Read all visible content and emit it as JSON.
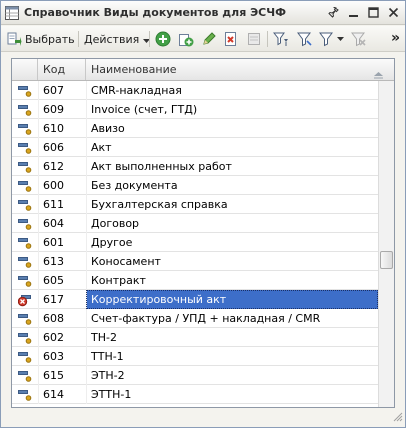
{
  "window": {
    "title": "Справочник Виды документов для ЭСЧФ"
  },
  "toolbar": {
    "select_label": "Выбрать",
    "actions_label": "Действия",
    "more_glyph": "»"
  },
  "grid": {
    "columns": {
      "code": "Код",
      "name": "Наименование"
    },
    "rows": [
      {
        "code": "607",
        "name": "CMR-накладная",
        "marked": false
      },
      {
        "code": "609",
        "name": "Invoice (счет, ГТД)",
        "marked": false
      },
      {
        "code": "610",
        "name": "Авизо",
        "marked": false
      },
      {
        "code": "606",
        "name": "Акт",
        "marked": false
      },
      {
        "code": "612",
        "name": "Акт выполненных работ",
        "marked": false
      },
      {
        "code": "600",
        "name": "Без документа",
        "marked": false
      },
      {
        "code": "611",
        "name": "Бухгалтерская справка",
        "marked": false
      },
      {
        "code": "604",
        "name": "Договор",
        "marked": false
      },
      {
        "code": "601",
        "name": "Другое",
        "marked": false
      },
      {
        "code": "613",
        "name": "Коносамент",
        "marked": false
      },
      {
        "code": "605",
        "name": "Контракт",
        "marked": false
      },
      {
        "code": "617",
        "name": "Корректировочный акт",
        "marked": true,
        "selected": true
      },
      {
        "code": "608",
        "name": "Счет-фактура / УПД + накладная / CMR",
        "marked": false
      },
      {
        "code": "602",
        "name": "ТН-2",
        "marked": false
      },
      {
        "code": "603",
        "name": "ТТН-1",
        "marked": false
      },
      {
        "code": "615",
        "name": "ЭТН-2",
        "marked": false
      },
      {
        "code": "614",
        "name": "ЭТТН-1",
        "marked": false
      }
    ]
  },
  "colors": {
    "selection": "#3d6ec9",
    "item_icon": "#5a7fb0",
    "item_key": "#d9a520",
    "delete_mark": "#d23a2a"
  }
}
